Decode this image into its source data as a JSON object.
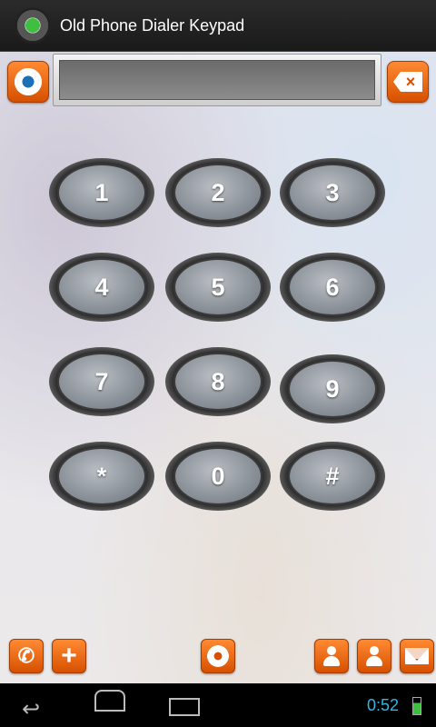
{
  "app": {
    "title": "Old Phone Dialer Keypad",
    "icon": "rotary-phone-icon"
  },
  "display": {
    "value": ""
  },
  "top_controls": {
    "settings_icon": "settings-gear-icon",
    "backspace_icon": "backspace-icon",
    "backspace_glyph": "×"
  },
  "keypad": {
    "keys": [
      "1",
      "2",
      "3",
      "4",
      "5",
      "6",
      "7",
      "8",
      "9",
      "*",
      "0",
      "#"
    ]
  },
  "toolbar": {
    "left": [
      "phone-icon",
      "add-contact-icon"
    ],
    "center": "rotary-dial-icon",
    "right": [
      "search-contact-icon",
      "contacts-icon",
      "mail-icon"
    ]
  },
  "system": {
    "clock": "0:52",
    "nav": [
      "back-icon",
      "home-icon",
      "recents-icon"
    ]
  },
  "colors": {
    "accent": "#e8650f",
    "titlebar": "#222222",
    "clock": "#33b5e5"
  }
}
